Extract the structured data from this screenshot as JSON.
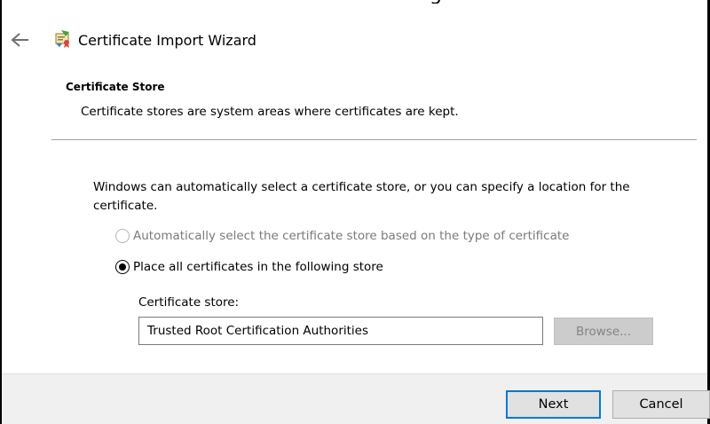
{
  "window": {
    "top_cut_text": "g",
    "title": "Certificate Import Wizard"
  },
  "header": {
    "section_title": "Certificate Store",
    "section_description": "Certificate stores are system areas where certificates are kept."
  },
  "main": {
    "body_text": "Windows can automatically select a certificate store, or you can specify a location for the certificate.",
    "options": [
      {
        "label": "Automatically select the certificate store based on the type of certificate",
        "selected": false,
        "enabled": false
      },
      {
        "label": "Place all certificates in the following store",
        "selected": true,
        "enabled": true
      }
    ],
    "store_label": "Certificate store:",
    "store_value": "Trusted Root Certification Authorities",
    "browse_label": "Browse..."
  },
  "footer": {
    "next_label": "Next",
    "cancel_label": "Cancel"
  },
  "icons": {
    "back": "back-arrow-icon",
    "app": "certificate-import-icon"
  },
  "colors": {
    "accent": "#0078d7",
    "footer_bg": "#f0f0f0",
    "disabled_text": "#7a7a7a"
  }
}
